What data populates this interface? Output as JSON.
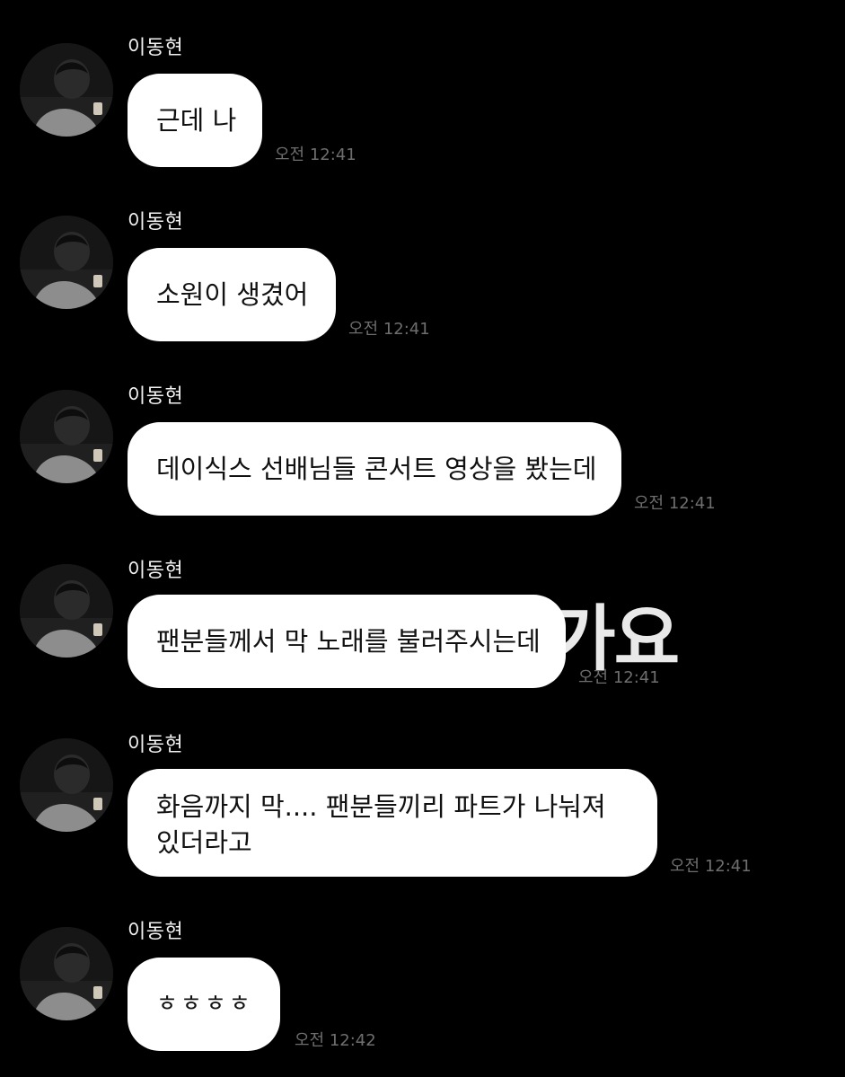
{
  "sender_name": "이동현",
  "overlay_text": "가요",
  "messages": [
    {
      "name": "이동현",
      "text": "근데 나",
      "time": "오전 12:41"
    },
    {
      "name": "이동현",
      "text": "소원이 생겼어",
      "time": "오전 12:41"
    },
    {
      "name": "이동현",
      "text": "데이식스 선배님들 콘서트 영상을 봤는데",
      "time": "오전 12:41"
    },
    {
      "name": "이동현",
      "text": "팬분들께서 막 노래를 불러주시는데",
      "time": "오전 12:41"
    },
    {
      "name": "이동현",
      "text": "화음까지 막.... 팬분들끼리 파트가 나눠져 있더라고",
      "time": "오전 12:41"
    },
    {
      "name": "이동현",
      "text": "ㅎㅎㅎㅎ",
      "time": "오전 12:42"
    }
  ],
  "colors": {
    "background": "#000000",
    "bubble": "#ffffff",
    "bubble_text": "#111111",
    "name_text": "#f2f2f2",
    "time_text": "#6e6e6e"
  },
  "icons": {
    "avatar": "profile-photo"
  }
}
